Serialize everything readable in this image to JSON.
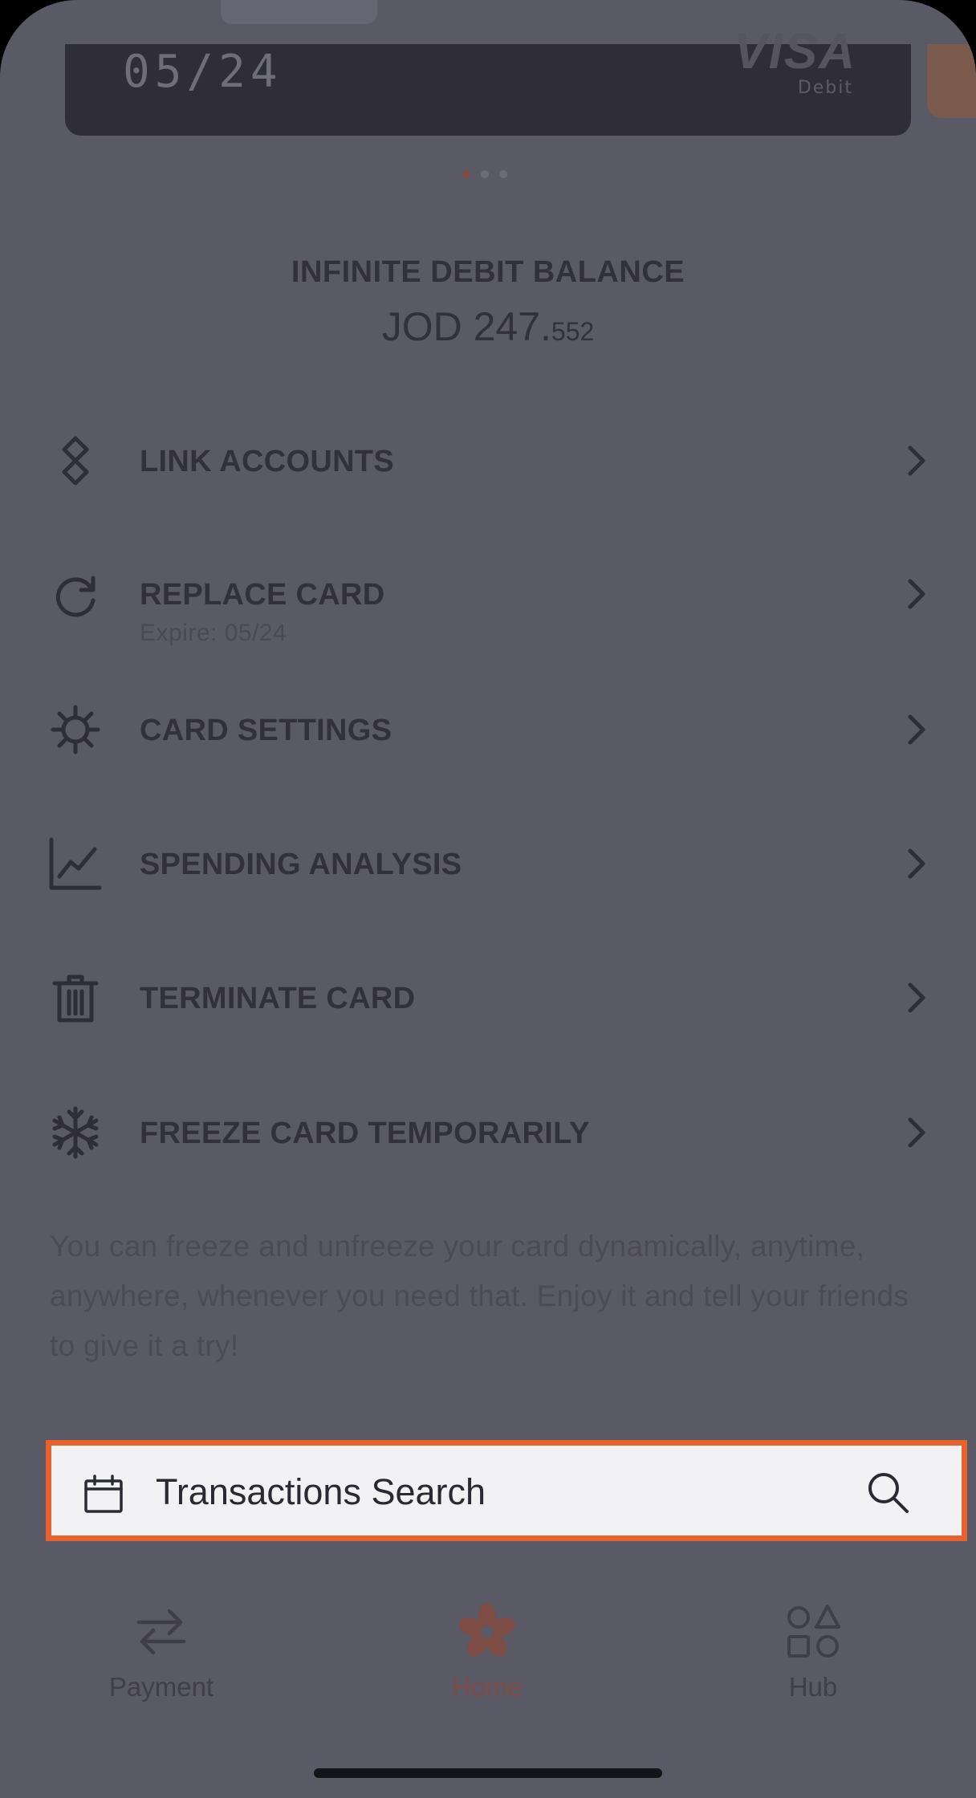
{
  "card": {
    "expiry": "05/24",
    "brand": "VISA",
    "type": "Debit",
    "pager_count": 3,
    "pager_active": 0
  },
  "balance": {
    "label": "INFINITE DEBIT BALANCE",
    "amount_main": "JOD 247.",
    "amount_decimal": "552"
  },
  "menu": {
    "items": [
      {
        "label": "LINK ACCOUNTS",
        "icon": "link-icon"
      },
      {
        "label": "REPLACE CARD",
        "sub": "Expire: 05/24",
        "icon": "refresh-icon"
      },
      {
        "label": "CARD SETTINGS",
        "icon": "gear-icon"
      },
      {
        "label": "SPENDING ANALYSIS",
        "icon": "line-chart-icon"
      },
      {
        "label": "TERMINATE CARD",
        "icon": "trash-icon"
      },
      {
        "label": "FREEZE CARD TEMPORARILY",
        "icon": "snowflake-icon"
      }
    ]
  },
  "freeze_note": "You can freeze and unfreeze your card dynamically, anytime, anywhere, whenever you need that. Enjoy it and tell your friends to give it a try!",
  "search": {
    "label": "Transactions Search",
    "highlight_color": "#e8622d"
  },
  "tabbar": {
    "tabs": [
      {
        "label": "Payment",
        "icon": "transfer-arrows-icon"
      },
      {
        "label": "Home",
        "icon": "flower-logo-icon",
        "active": true
      },
      {
        "label": "Hub",
        "icon": "shapes-icon"
      }
    ]
  },
  "colors": {
    "overlay_background": "#5a5966",
    "accent": "#7c4c45"
  }
}
